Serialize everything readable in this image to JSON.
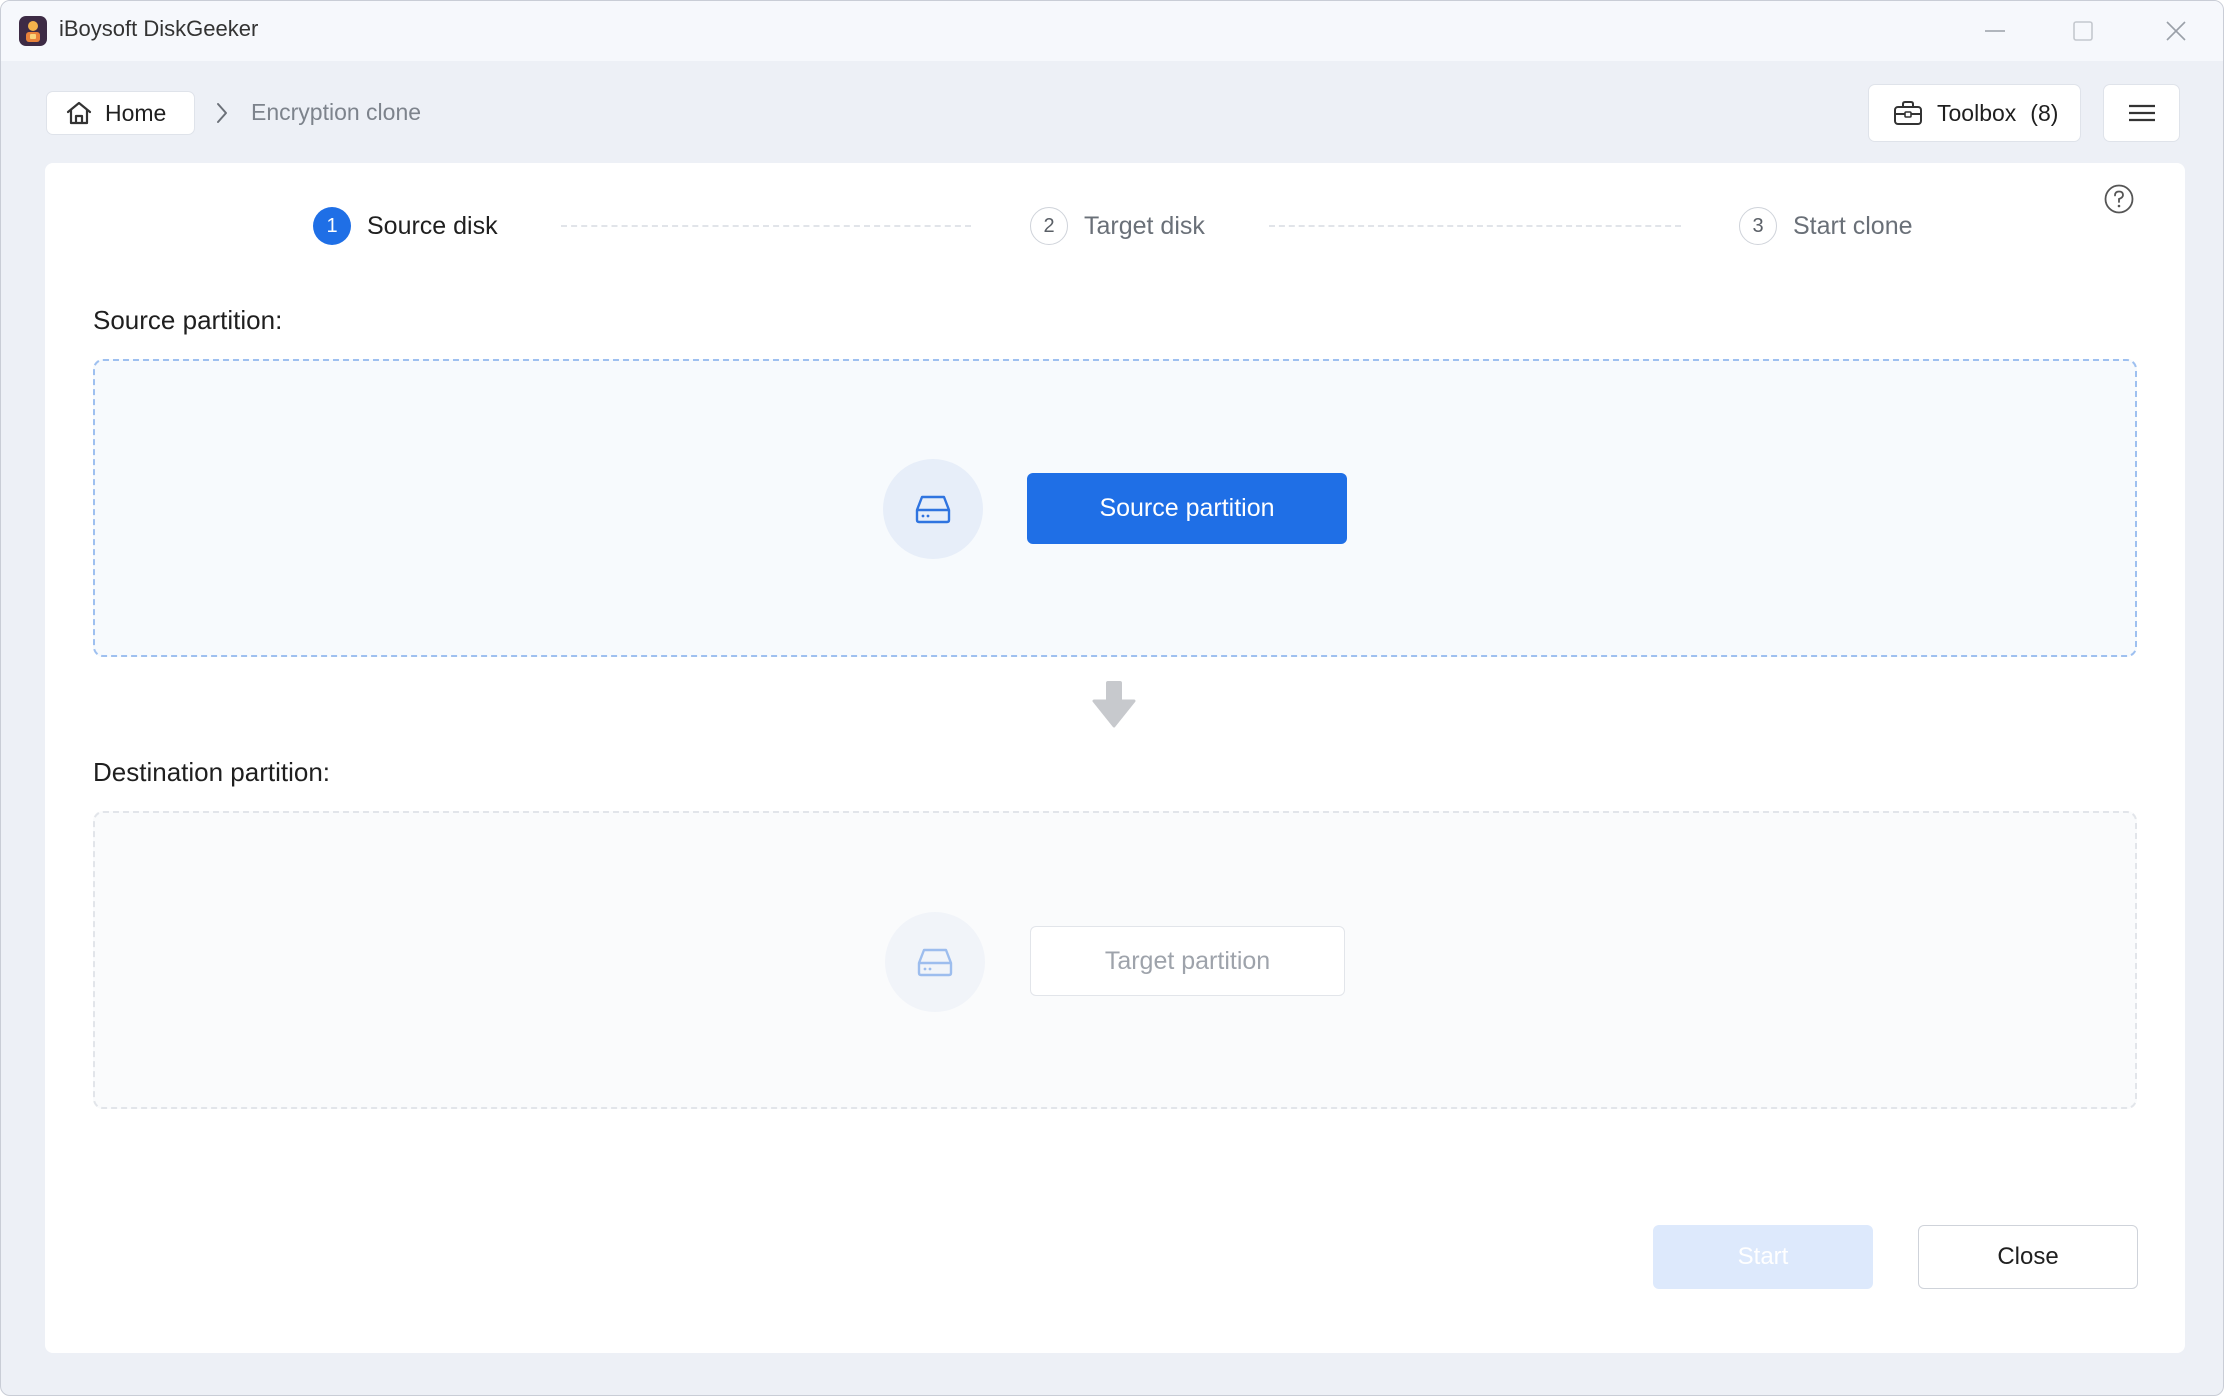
{
  "window": {
    "title": "iBoysoft DiskGeeker",
    "controls": [
      "minimize-icon",
      "maximize-icon",
      "close-icon"
    ]
  },
  "breadcrumb": {
    "home_label": "Home",
    "home_icon": "home-icon",
    "separator_icon": "chevron-right-icon",
    "current": "Encryption clone"
  },
  "header": {
    "toolbox_label": "Toolbox",
    "toolbox_count": "(8)",
    "toolbox_icon": "toolbox-icon",
    "menu_icon": "hamburger-menu-icon",
    "help_icon": "help-circle-icon"
  },
  "steps": [
    {
      "number": "1",
      "label": "Source disk",
      "state": "active"
    },
    {
      "number": "2",
      "label": "Target disk",
      "state": "inactive"
    },
    {
      "number": "3",
      "label": "Start clone",
      "state": "inactive"
    }
  ],
  "source": {
    "section_label": "Source partition:",
    "button_label": "Source partition",
    "icon": "hard-drive-icon"
  },
  "destination": {
    "section_label": "Destination partition:",
    "button_label": "Target partition",
    "icon": "hard-drive-icon"
  },
  "arrow_icon": "arrow-down-icon",
  "footer": {
    "start_label": "Start",
    "start_enabled": false,
    "close_label": "Close"
  },
  "colors": {
    "accent": "#1f6fe6",
    "window_bg": "#edf0f6",
    "start_disabled_bg": "#dde9fc",
    "source_box_border": "#9ec0f0"
  }
}
